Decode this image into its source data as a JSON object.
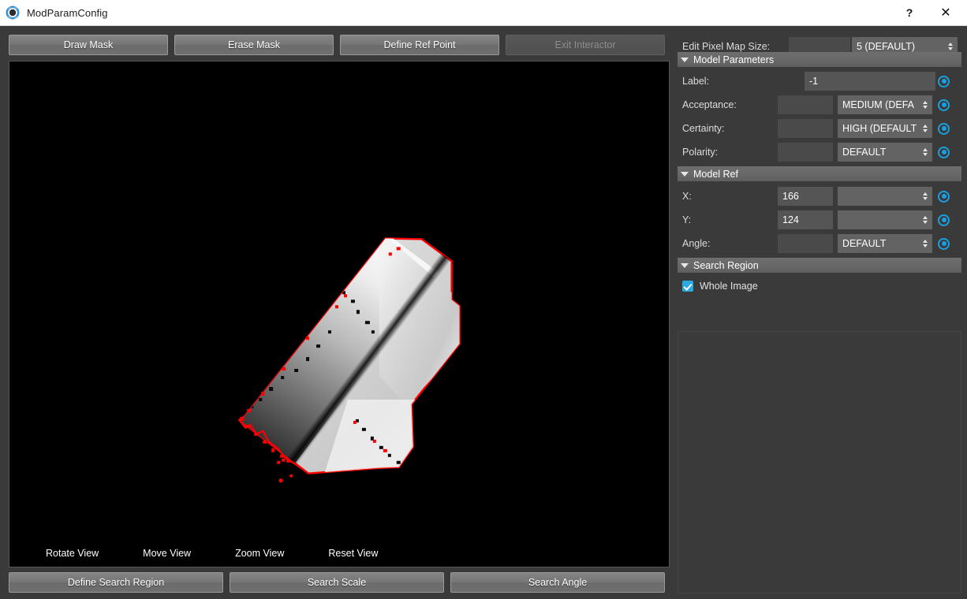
{
  "titlebar": {
    "title": "ModParamConfig",
    "app_icon": "target-ring-icon",
    "help_label": "?",
    "close_label": "✕"
  },
  "toolbar_top": {
    "buttons": [
      {
        "label": "Draw Mask",
        "name": "draw-mask-button",
        "disabled": false
      },
      {
        "label": "Erase Mask",
        "name": "erase-mask-button",
        "disabled": false
      },
      {
        "label": "Define Ref Point",
        "name": "define-ref-point-button",
        "disabled": false
      },
      {
        "label": "Exit Interactor",
        "name": "exit-interactor-button",
        "disabled": true
      }
    ]
  },
  "toolbar_bottom": {
    "buttons": [
      {
        "label": "Define Search Region",
        "name": "define-search-region-button"
      },
      {
        "label": "Search Scale",
        "name": "search-scale-button"
      },
      {
        "label": "Search Angle",
        "name": "search-angle-button"
      }
    ]
  },
  "viewport": {
    "controls": [
      "Rotate View",
      "Move View",
      "Zoom View",
      "Reset View"
    ],
    "background_color": "#000000",
    "object_outline_color": "#ff0000"
  },
  "panel": {
    "pixel_map": {
      "label": "Edit Pixel Map Size:",
      "field_value": "",
      "combo_value": "5 (DEFAULT)"
    },
    "model_parameters": {
      "header": "Model Parameters",
      "rows": [
        {
          "label": "Label:",
          "field_value": "-1",
          "combo_value": "",
          "has_combo": false,
          "has_radio": true
        },
        {
          "label": "Acceptance:",
          "field_value": "",
          "combo_value": "MEDIUM (DEFA",
          "has_combo": true,
          "has_radio": true
        },
        {
          "label": "Certainty:",
          "field_value": "",
          "combo_value": "HIGH (DEFAULT",
          "has_combo": true,
          "has_radio": true
        },
        {
          "label": "Polarity:",
          "field_value": "",
          "combo_value": "DEFAULT",
          "has_combo": true,
          "has_radio": true
        }
      ]
    },
    "model_ref": {
      "header": "Model Ref",
      "rows": [
        {
          "label": "X:",
          "field_value": "166",
          "combo_value": "",
          "has_combo": true,
          "has_radio": true
        },
        {
          "label": "Y:",
          "field_value": "124",
          "combo_value": "",
          "has_combo": true,
          "has_radio": true
        },
        {
          "label": "Angle:",
          "field_value": "",
          "combo_value": "DEFAULT",
          "has_combo": true,
          "has_radio": true
        }
      ]
    },
    "search_region": {
      "header": "Search Region",
      "checkbox_label": "Whole Image",
      "checked": true
    }
  },
  "colors": {
    "accent": "#29abe2",
    "panel_bg": "#3a3a3a",
    "button_face": "#767676",
    "outline_red": "#ff0000"
  }
}
